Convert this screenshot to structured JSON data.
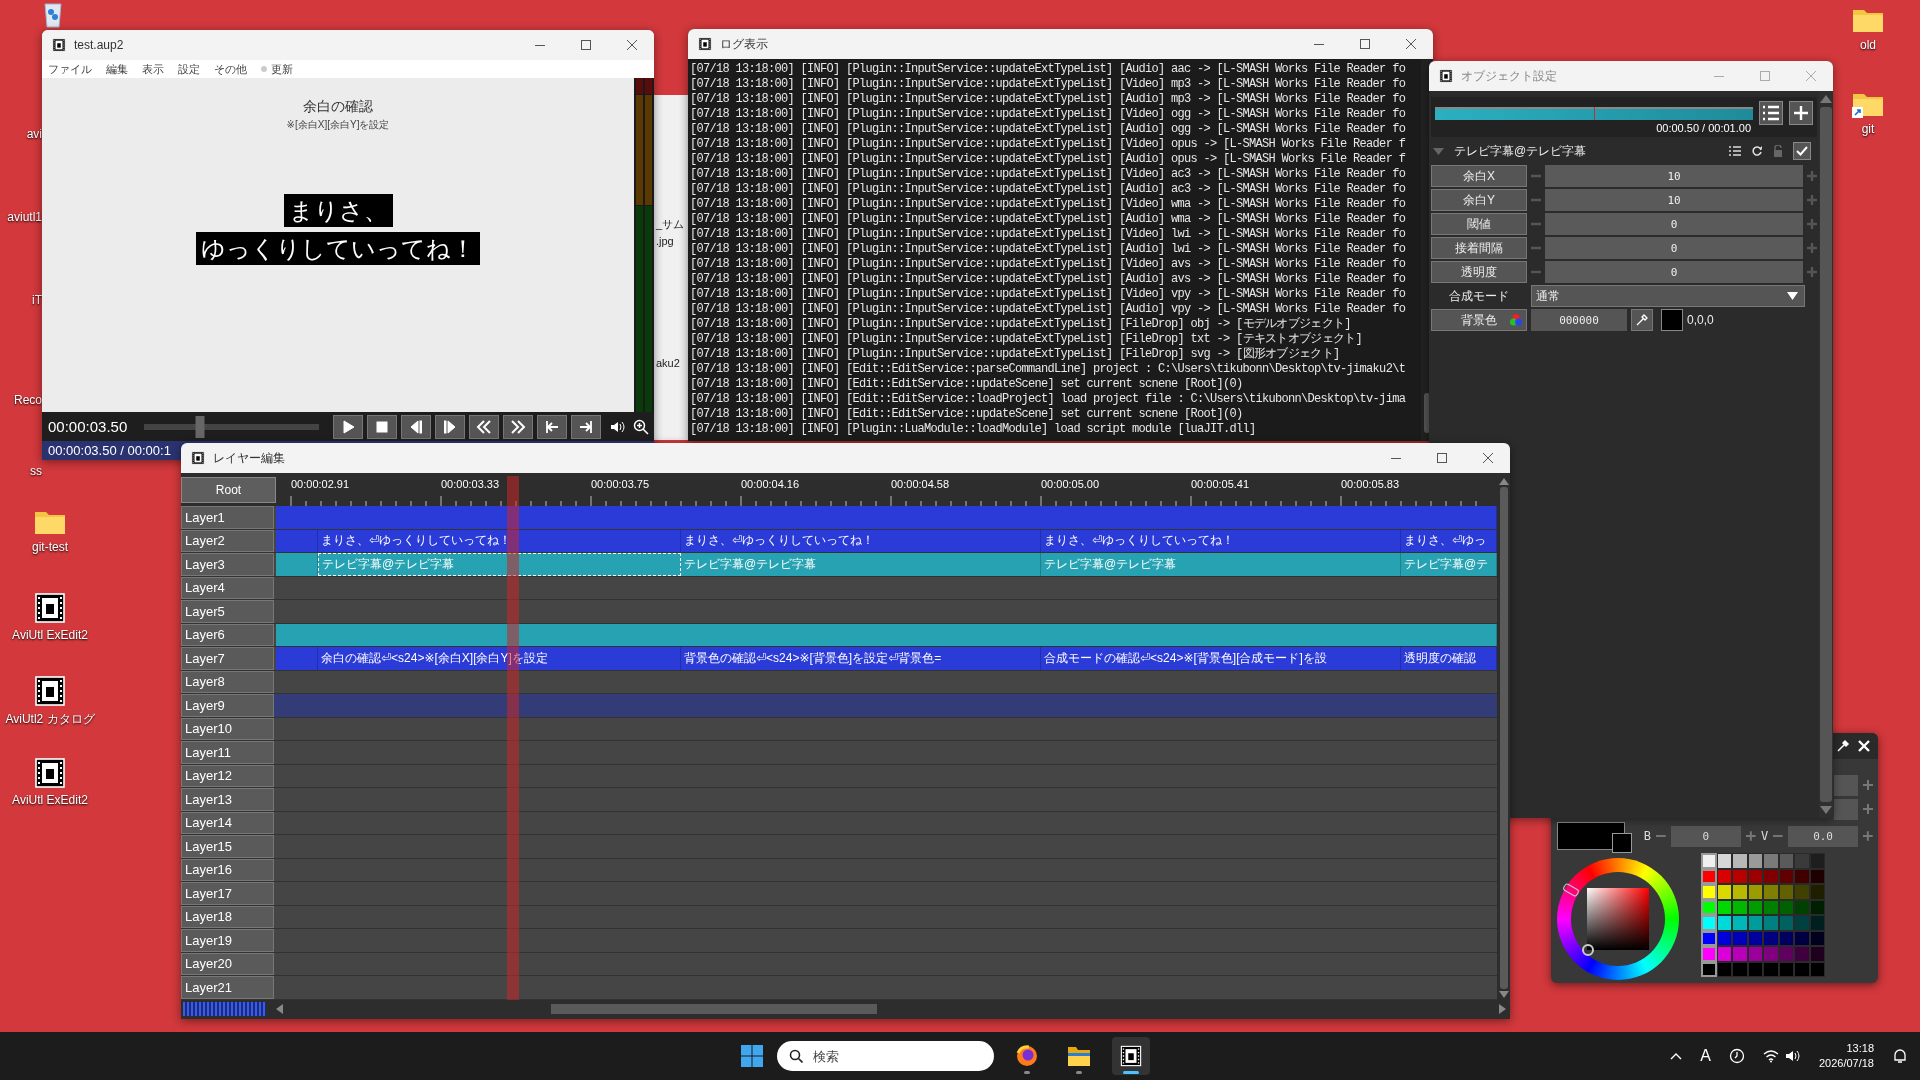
{
  "desktop": {
    "icons": [
      {
        "kind": "partial",
        "label": "avi"
      },
      {
        "kind": "partial",
        "label": "aviutl1"
      },
      {
        "kind": "partial",
        "label": "iT"
      },
      {
        "kind": "partial",
        "label": "Reco"
      },
      {
        "kind": "partial",
        "label": "ss"
      },
      {
        "kind": "folder",
        "label": "git-test"
      },
      {
        "kind": "app",
        "label": "AviUtl ExEdit2"
      },
      {
        "kind": "app",
        "label": "AviUtl2 カタログ"
      },
      {
        "kind": "app",
        "label": "AviUtl ExEdit2"
      },
      {
        "kind": "folder",
        "label": "old"
      },
      {
        "kind": "folder_shortcut",
        "label": "git"
      }
    ]
  },
  "background_window": {
    "texts": [
      "_サム",
      ".jpg",
      "aku2"
    ]
  },
  "preview_window": {
    "title": "test.aup2",
    "menu": [
      "ファイル",
      "編集",
      "表示",
      "設定",
      "その他"
    ],
    "update_button": "更新",
    "heading": "余白の確認",
    "subheading": "※[余白X][余白Y]を設定",
    "caption_lines": [
      "まりさ、",
      "ゆっくりしていってね！"
    ],
    "time": "00:00:03.50",
    "seek": {
      "level": 0.32
    },
    "status": "00:00:03.50 / 00:00:1"
  },
  "log_window": {
    "title": "ログ表示",
    "lines": [
      "[07/18 13:18:00] [INFO] [Plugin::InputService::updateExtTypeList] [Audio] aac -> [L-SMASH Works File Reader fo",
      "[07/18 13:18:00] [INFO] [Plugin::InputService::updateExtTypeList] [Video] mp3 -> [L-SMASH Works File Reader fo",
      "[07/18 13:18:00] [INFO] [Plugin::InputService::updateExtTypeList] [Audio] mp3 -> [L-SMASH Works File Reader fo",
      "[07/18 13:18:00] [INFO] [Plugin::InputService::updateExtTypeList] [Video] ogg -> [L-SMASH Works File Reader fo",
      "[07/18 13:18:00] [INFO] [Plugin::InputService::updateExtTypeList] [Audio] ogg -> [L-SMASH Works File Reader fo",
      "[07/18 13:18:00] [INFO] [Plugin::InputService::updateExtTypeList] [Video] opus -> [L-SMASH Works File Reader f",
      "[07/18 13:18:00] [INFO] [Plugin::InputService::updateExtTypeList] [Audio] opus -> [L-SMASH Works File Reader f",
      "[07/18 13:18:00] [INFO] [Plugin::InputService::updateExtTypeList] [Video] ac3 -> [L-SMASH Works File Reader fo",
      "[07/18 13:18:00] [INFO] [Plugin::InputService::updateExtTypeList] [Audio] ac3 -> [L-SMASH Works File Reader fo",
      "[07/18 13:18:00] [INFO] [Plugin::InputService::updateExtTypeList] [Video] wma -> [L-SMASH Works File Reader fo",
      "[07/18 13:18:00] [INFO] [Plugin::InputService::updateExtTypeList] [Audio] wma -> [L-SMASH Works File Reader fo",
      "[07/18 13:18:00] [INFO] [Plugin::InputService::updateExtTypeList] [Video] lwi -> [L-SMASH Works File Reader fo",
      "[07/18 13:18:00] [INFO] [Plugin::InputService::updateExtTypeList] [Audio] lwi -> [L-SMASH Works File Reader fo",
      "[07/18 13:18:00] [INFO] [Plugin::InputService::updateExtTypeList] [Video] avs -> [L-SMASH Works File Reader fo",
      "[07/18 13:18:00] [INFO] [Plugin::InputService::updateExtTypeList] [Audio] avs -> [L-SMASH Works File Reader fo",
      "[07/18 13:18:00] [INFO] [Plugin::InputService::updateExtTypeList] [Video] vpy -> [L-SMASH Works File Reader fo",
      "[07/18 13:18:00] [INFO] [Plugin::InputService::updateExtTypeList] [Audio] vpy -> [L-SMASH Works File Reader fo",
      "[07/18 13:18:00] [INFO] [Plugin::InputService::updateExtTypeList] [FileDrop] obj -> [モデルオブジェクト]",
      "[07/18 13:18:00] [INFO] [Plugin::InputService::updateExtTypeList] [FileDrop] txt -> [テキストオブジェクト]",
      "[07/18 13:18:00] [INFO] [Plugin::InputService::updateExtTypeList] [FileDrop] svg -> [図形オブジェクト]",
      "[07/18 13:18:00] [INFO] [Edit::EditService::parseCommandLine] project : C:\\Users\\tikubonn\\Desktop\\tv-jimaku2\\t",
      "[07/18 13:18:00] [INFO] [Edit::EditService::updateScene] set current scnene [Root](0)",
      "[07/18 13:18:00] [INFO] [Edit::EditService::loadProject] load project file : C:\\Users\\tikubonn\\Desktop\\tv-jima",
      "[07/18 13:18:00] [INFO] [Edit::EditService::updateScene] set current scnene [Root](0)",
      "[07/18 13:18:00] [INFO] [Plugin::LuaModule::loadModule] load script module [luaJIT.dll]"
    ]
  },
  "object_settings": {
    "title": "オブジェクト設定",
    "timeline": {
      "time": "00:00.50 / 00:01.00",
      "level": 0.5
    },
    "section": {
      "title": "テレビ字幕@テレビ字幕",
      "expanded": true,
      "enabled": true
    },
    "params": [
      {
        "kind": "number",
        "label": "余白X",
        "value": "10"
      },
      {
        "kind": "number",
        "label": "余白Y",
        "value": "10"
      },
      {
        "kind": "number",
        "label": "閾値",
        "value": "0"
      },
      {
        "kind": "number",
        "label": "接着間隔",
        "value": "0"
      },
      {
        "kind": "number",
        "label": "透明度",
        "value": "0"
      },
      {
        "kind": "select",
        "label": "合成モード",
        "value": "通常"
      },
      {
        "kind": "color",
        "label": "背景色",
        "value": "000000",
        "rgb": "0,0,0",
        "color": "#000000"
      }
    ]
  },
  "color_picker": {
    "fields": [
      {
        "label": "B",
        "value": "0"
      },
      {
        "label": "V",
        "value": "0.0"
      }
    ],
    "color": "#000000"
  },
  "layer_editor": {
    "title": "レイヤー編集",
    "scene": "Root",
    "zoom": {
      "level": 1
    },
    "ruler": [
      "00:00:02.91",
      "00:00:03.33",
      "00:00:03.75",
      "00:00:04.16",
      "00:00:04.58",
      "00:00:05.00",
      "00:00:05.41",
      "00:00:05.83"
    ],
    "playhead": {
      "level": 0.19
    },
    "layers": [
      {
        "name": "Layer1",
        "selected": false,
        "clips": [
          {
            "color": "#2b3bd8",
            "selected": false
          }
        ]
      },
      {
        "name": "Layer2",
        "selected": false,
        "clips": [
          {
            "color": "#2b3bd8",
            "selected": false
          },
          {
            "color": "#2b3bd8",
            "selected": false,
            "text": "まりさ、⏎ゆっくりしていってね！"
          },
          {
            "color": "#2b3bd8",
            "selected": false,
            "text": "まりさ、⏎ゆっくりしていってね！"
          },
          {
            "color": "#2b3bd8",
            "selected": false,
            "text": "まりさ、⏎ゆっくりしていってね！"
          },
          {
            "color": "#2b3bd8",
            "selected": false,
            "text": "まりさ、⏎ゆっ"
          }
        ]
      },
      {
        "name": "Layer3",
        "selected": false,
        "clips": [
          {
            "color": "#26a2b2",
            "selected": false
          },
          {
            "color": "#26a2b2",
            "selected": true,
            "text": "テレビ字幕@テレビ字幕"
          },
          {
            "color": "#26a2b2",
            "selected": false,
            "text": "テレビ字幕@テレビ字幕"
          },
          {
            "color": "#26a2b2",
            "selected": false,
            "text": "テレビ字幕@テレビ字幕"
          },
          {
            "color": "#26a2b2",
            "selected": false,
            "text": "テレビ字幕@テ"
          }
        ]
      },
      {
        "name": "Layer4",
        "selected": false
      },
      {
        "name": "Layer5",
        "selected": false
      },
      {
        "name": "Layer6",
        "selected": false,
        "clips": [
          {
            "color": "#26a2b2",
            "selected": false
          }
        ]
      },
      {
        "name": "Layer7",
        "selected": false,
        "clips": [
          {
            "color": "#2b3bd8",
            "selected": false
          },
          {
            "color": "#2b3bd8",
            "selected": false,
            "text": "余白の確認⏎<s24>※[余白X][余白Y]を設定"
          },
          {
            "color": "#2b3bd8",
            "selected": false,
            "text": "背景色の確認⏎<s24>※[背景色]を設定⏎背景色="
          },
          {
            "color": "#2b3bd8",
            "selected": false,
            "text": "合成モードの確認⏎<s24>※[背景色][合成モード]を設"
          },
          {
            "color": "#2b3bd8",
            "selected": false,
            "text": "透明度の確認"
          }
        ]
      },
      {
        "name": "Layer8",
        "selected": false
      },
      {
        "name": "Layer9",
        "selected": true
      },
      {
        "name": "Layer10",
        "selected": false
      },
      {
        "name": "Layer11",
        "selected": false
      },
      {
        "name": "Layer12",
        "selected": false
      },
      {
        "name": "Layer13",
        "selected": false
      },
      {
        "name": "Layer14",
        "selected": false
      },
      {
        "name": "Layer15",
        "selected": false
      },
      {
        "name": "Layer16",
        "selected": false
      },
      {
        "name": "Layer17",
        "selected": false
      },
      {
        "name": "Layer18",
        "selected": false
      },
      {
        "name": "Layer19",
        "selected": false
      },
      {
        "name": "Layer20",
        "selected": false
      },
      {
        "name": "Layer21",
        "selected": false
      }
    ]
  },
  "taskbar": {
    "search_placeholder": "検索",
    "apps": [
      {
        "kind": "browser",
        "selected": false
      },
      {
        "kind": "folder",
        "selected": false
      },
      {
        "kind": "editor",
        "selected": true
      }
    ],
    "ime": "A",
    "time": "13:18",
    "date": "2026/07/18"
  }
}
